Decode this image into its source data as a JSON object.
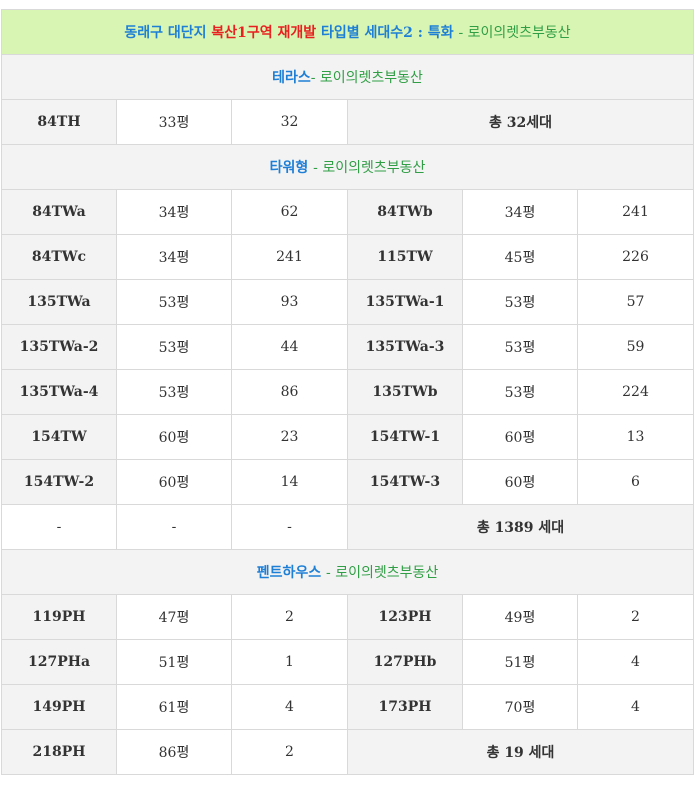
{
  "title": {
    "part1": "동래구 대단지",
    "part2": "복산1구역 재개발",
    "part3": "타입별 세대수2 : 특화",
    "part4": "- 로이의렛츠부동산"
  },
  "sections": {
    "terrace": {
      "label": "테라스",
      "suffix": "- 로이의렛츠부동산"
    },
    "tower": {
      "label": "타워형",
      "suffix": "- 로이의렛츠부동산"
    },
    "penthouse": {
      "label": "펜트하우스",
      "suffix": "- 로이의렛츠부동산"
    }
  },
  "terrace_row": {
    "type": "84TH",
    "size": "33평",
    "count": "32",
    "total": "총 32세대"
  },
  "tower_rows": [
    {
      "type_a": "84TWa",
      "size_a": "34평",
      "count_a": "62",
      "type_b": "84TWb",
      "size_b": "34평",
      "count_b": "241"
    },
    {
      "type_a": "84TWc",
      "size_a": "34평",
      "count_a": "241",
      "type_b": "115TW",
      "size_b": "45평",
      "count_b": "226"
    },
    {
      "type_a": "135TWa",
      "size_a": "53평",
      "count_a": "93",
      "type_b": "135TWa-1",
      "size_b": "53평",
      "count_b": "57"
    },
    {
      "type_a": "135TWa-2",
      "size_a": "53평",
      "count_a": "44",
      "type_b": "135TWa-3",
      "size_b": "53평",
      "count_b": "59"
    },
    {
      "type_a": "135TWa-4",
      "size_a": "53평",
      "count_a": "86",
      "type_b": "135TWb",
      "size_b": "53평",
      "count_b": "224"
    },
    {
      "type_a": "154TW",
      "size_a": "60평",
      "count_a": "23",
      "type_b": "154TW-1",
      "size_b": "60평",
      "count_b": "13"
    },
    {
      "type_a": "154TW-2",
      "size_a": "60평",
      "count_a": "14",
      "type_b": "154TW-3",
      "size_b": "60평",
      "count_b": "6"
    }
  ],
  "tower_total_row": {
    "dash1": "-",
    "dash2": "-",
    "dash3": "-",
    "total": "총 1389 세대"
  },
  "penthouse_rows": [
    {
      "type_a": "119PH",
      "size_a": "47평",
      "count_a": "2",
      "type_b": "123PH",
      "size_b": "49평",
      "count_b": "2"
    },
    {
      "type_a": "127PHa",
      "size_a": "51평",
      "count_a": "1",
      "type_b": "127PHb",
      "size_b": "51평",
      "count_b": "4"
    },
    {
      "type_a": "149PH",
      "size_a": "61평",
      "count_a": "4",
      "type_b": "173PH",
      "size_b": "70평",
      "count_b": "4"
    }
  ],
  "penthouse_last_row": {
    "type": "218PH",
    "size": "86평",
    "count": "2",
    "total": "총 19 세대"
  },
  "colors": {
    "title_bg": "#d9f5b3",
    "header_bg": "#f3f3f3",
    "type_text": "#1e7fd6",
    "accent_red": "#e82020",
    "accent_green": "#2f9e44"
  }
}
